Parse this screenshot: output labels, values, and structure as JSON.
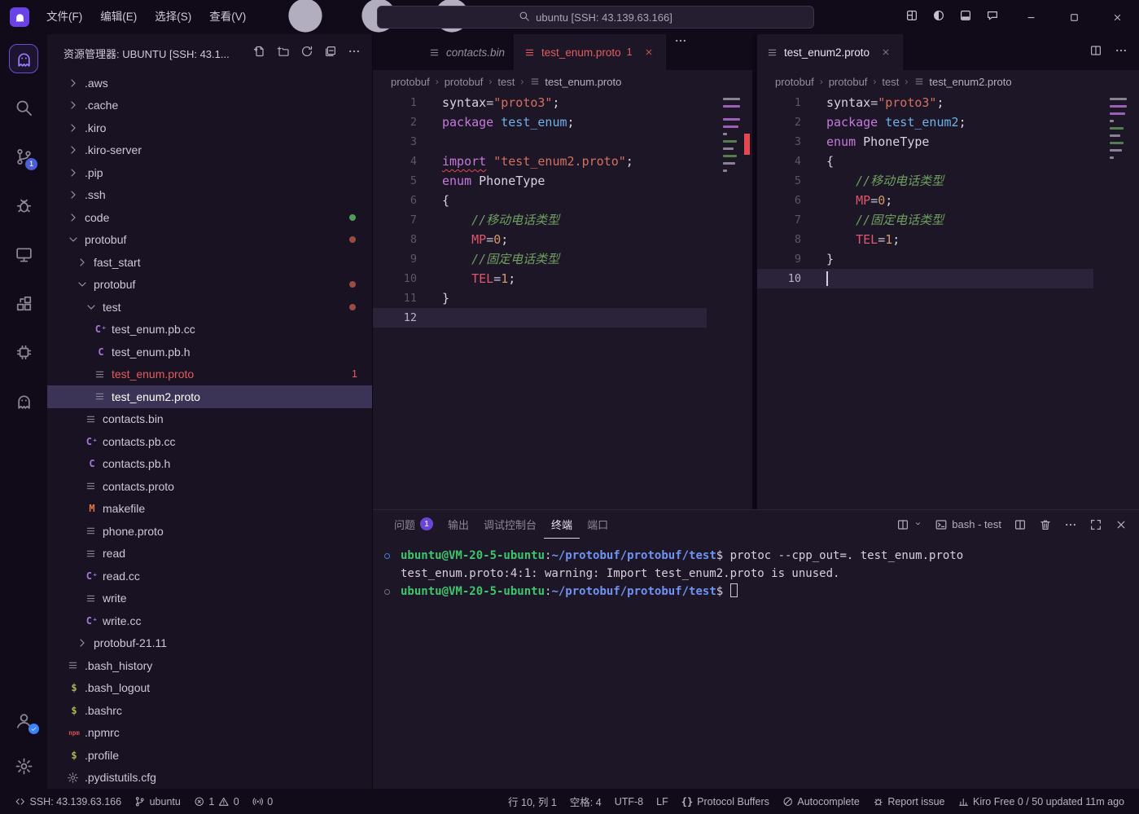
{
  "window": {
    "menus": [
      "文件(F)",
      "编辑(E)",
      "选择(S)",
      "查看(V)"
    ],
    "back": "←",
    "forward": "→",
    "search_text": "ubuntu [SSH: 43.139.63.166]",
    "title_actions": [
      {
        "name": "customize-layout",
        "icon": "layout-grid"
      },
      {
        "name": "toggle-sidebar",
        "icon": "circle-half"
      },
      {
        "name": "toggle-panel",
        "icon": "panel-bottom"
      },
      {
        "name": "chat",
        "icon": "chat"
      }
    ],
    "controls": [
      {
        "name": "minimize",
        "icon": "minimize"
      },
      {
        "name": "maximize",
        "icon": "maximize"
      },
      {
        "name": "close-window",
        "icon": "close"
      }
    ]
  },
  "activity_bar": {
    "top": [
      {
        "name": "kiro",
        "icon": "ghost",
        "active": true
      },
      {
        "name": "search",
        "icon": "search"
      },
      {
        "name": "source-control",
        "icon": "source-control",
        "badge": "1"
      },
      {
        "name": "run-debug",
        "icon": "debug"
      },
      {
        "name": "remote-explorer",
        "icon": "monitor"
      },
      {
        "name": "extensions",
        "icon": "extensions"
      },
      {
        "name": "kiro-agent",
        "icon": "cpu"
      },
      {
        "name": "kiro-chat",
        "icon": "ghost"
      }
    ],
    "bottom": [
      {
        "name": "accounts",
        "icon": "account",
        "check": true
      },
      {
        "name": "settings",
        "icon": "gear"
      }
    ]
  },
  "sidebar": {
    "title": "资源管理器: UBUNTU [SSH: 43.1...",
    "actions": [
      {
        "name": "new-file",
        "icon": "new-file"
      },
      {
        "name": "new-folder",
        "icon": "new-folder"
      },
      {
        "name": "refresh-explorer",
        "icon": "refresh"
      },
      {
        "name": "collapse-folders",
        "icon": "collapse-all"
      },
      {
        "name": "views-more",
        "icon": "more"
      }
    ],
    "tree": [
      {
        "label": ".aws",
        "depth": 0,
        "kind": "folder"
      },
      {
        "label": ".cache",
        "depth": 0,
        "kind": "folder"
      },
      {
        "label": ".kiro",
        "depth": 0,
        "kind": "folder"
      },
      {
        "label": ".kiro-server",
        "depth": 0,
        "kind": "folder"
      },
      {
        "label": ".pip",
        "depth": 0,
        "kind": "folder"
      },
      {
        "label": ".ssh",
        "depth": 0,
        "kind": "folder"
      },
      {
        "label": "code",
        "depth": 0,
        "kind": "folder",
        "dot": "green"
      },
      {
        "label": "protobuf",
        "depth": 0,
        "kind": "folder",
        "expanded": true,
        "dot": "red"
      },
      {
        "label": "fast_start",
        "depth": 1,
        "kind": "folder"
      },
      {
        "label": "protobuf",
        "depth": 1,
        "kind": "folder",
        "expanded": true,
        "dot": "red"
      },
      {
        "label": "test",
        "depth": 2,
        "kind": "folder",
        "expanded": true,
        "dot": "red"
      },
      {
        "label": "test_enum.pb.cc",
        "depth": 3,
        "kind": "file",
        "icon": "cpp"
      },
      {
        "label": "test_enum.pb.h",
        "depth": 3,
        "kind": "file",
        "icon": "c"
      },
      {
        "label": "test_enum.proto",
        "depth": 3,
        "kind": "file",
        "icon": "lines",
        "error": true,
        "badge": "1"
      },
      {
        "label": "test_enum2.proto",
        "depth": 3,
        "kind": "file",
        "icon": "lines",
        "selected": true
      },
      {
        "label": "contacts.bin",
        "depth": 2,
        "kind": "file",
        "icon": "lines"
      },
      {
        "label": "contacts.pb.cc",
        "depth": 2,
        "kind": "file",
        "icon": "cpp"
      },
      {
        "label": "contacts.pb.h",
        "depth": 2,
        "kind": "file",
        "icon": "c"
      },
      {
        "label": "contacts.proto",
        "depth": 2,
        "kind": "file",
        "icon": "lines"
      },
      {
        "label": "makefile",
        "depth": 2,
        "kind": "file",
        "icon": "make"
      },
      {
        "label": "phone.proto",
        "depth": 2,
        "kind": "file",
        "icon": "lines"
      },
      {
        "label": "read",
        "depth": 2,
        "kind": "file",
        "icon": "lines"
      },
      {
        "label": "read.cc",
        "depth": 2,
        "kind": "file",
        "icon": "cpp"
      },
      {
        "label": "write",
        "depth": 2,
        "kind": "file",
        "icon": "lines"
      },
      {
        "label": "write.cc",
        "depth": 2,
        "kind": "file",
        "icon": "cpp"
      },
      {
        "label": "protobuf-21.11",
        "depth": 1,
        "kind": "folder"
      },
      {
        "label": ".bash_history",
        "depth": 0,
        "kind": "file",
        "icon": "lines"
      },
      {
        "label": ".bash_logout",
        "depth": 0,
        "kind": "file",
        "icon": "shell"
      },
      {
        "label": ".bashrc",
        "depth": 0,
        "kind": "file",
        "icon": "shell"
      },
      {
        "label": ".npmrc",
        "depth": 0,
        "kind": "file",
        "icon": "npm"
      },
      {
        "label": ".profile",
        "depth": 0,
        "kind": "file",
        "icon": "shell"
      },
      {
        "label": ".pydistutils.cfg",
        "depth": 0,
        "kind": "file",
        "icon": "gear"
      }
    ]
  },
  "editor_groups": [
    {
      "tabs": [
        {
          "label": "contacts.bin",
          "icon": "lines",
          "preview": true
        },
        {
          "label": "test_enum.proto",
          "icon": "lines",
          "error": true,
          "count": "1",
          "close": true,
          "active": true
        }
      ],
      "overflow": true,
      "breadcrumbs": [
        "protobuf",
        "protobuf",
        "test"
      ],
      "file": "test_enum.proto",
      "active_line": 12,
      "cursor": false,
      "error_mark": true,
      "code": [
        [
          [
            "p",
            "syntax"
          ],
          [
            "o",
            "="
          ],
          [
            "s",
            "\"proto3\""
          ],
          [
            "p",
            ";"
          ]
        ],
        [
          [
            "k",
            "package"
          ],
          [
            "p",
            " "
          ],
          [
            "t",
            "test_enum"
          ],
          [
            "p",
            ";"
          ]
        ],
        [],
        [
          [
            "kq",
            "import"
          ],
          [
            "p",
            " "
          ],
          [
            "s",
            "\"test_enum2.proto\""
          ],
          [
            "p",
            ";"
          ]
        ],
        [
          [
            "k",
            "enum"
          ],
          [
            "p",
            " "
          ],
          [
            "p",
            "PhoneType"
          ]
        ],
        [
          [
            "p",
            "{"
          ]
        ],
        [
          [
            "c",
            "    //移动电话类型"
          ]
        ],
        [
          [
            "p",
            "    "
          ],
          [
            "v",
            "MP"
          ],
          [
            "o",
            "="
          ],
          [
            "n",
            "0"
          ],
          [
            "p",
            ";"
          ]
        ],
        [
          [
            "c",
            "    //固定电话类型"
          ]
        ],
        [
          [
            "p",
            "    "
          ],
          [
            "v",
            "TEL"
          ],
          [
            "o",
            "="
          ],
          [
            "n",
            "1"
          ],
          [
            "p",
            ";"
          ]
        ],
        [
          [
            "p",
            "}"
          ]
        ],
        []
      ]
    },
    {
      "tabs": [
        {
          "label": "test_enum2.proto",
          "icon": "lines",
          "close": true,
          "active": true
        }
      ],
      "actions": [
        {
          "name": "split-editor",
          "icon": "split-editor"
        },
        {
          "name": "editor-more",
          "icon": "more"
        }
      ],
      "breadcrumbs": [
        "protobuf",
        "protobuf",
        "test"
      ],
      "file": "test_enum2.proto",
      "active_line": 10,
      "cursor": true,
      "error_mark": false,
      "code": [
        [
          [
            "p",
            "syntax"
          ],
          [
            "o",
            "="
          ],
          [
            "s",
            "\"proto3\""
          ],
          [
            "p",
            ";"
          ]
        ],
        [
          [
            "k",
            "package"
          ],
          [
            "p",
            " "
          ],
          [
            "t",
            "test_enum2"
          ],
          [
            "p",
            ";"
          ]
        ],
        [
          [
            "k",
            "enum"
          ],
          [
            "p",
            " "
          ],
          [
            "p",
            "PhoneType"
          ]
        ],
        [
          [
            "p",
            "{"
          ]
        ],
        [
          [
            "c",
            "    //移动电话类型"
          ]
        ],
        [
          [
            "p",
            "    "
          ],
          [
            "v",
            "MP"
          ],
          [
            "o",
            "="
          ],
          [
            "n",
            "0"
          ],
          [
            "p",
            ";"
          ]
        ],
        [
          [
            "c",
            "    //固定电话类型"
          ]
        ],
        [
          [
            "p",
            "    "
          ],
          [
            "v",
            "TEL"
          ],
          [
            "o",
            "="
          ],
          [
            "n",
            "1"
          ],
          [
            "p",
            ";"
          ]
        ],
        [
          [
            "p",
            "}"
          ]
        ],
        []
      ]
    }
  ],
  "panel": {
    "tabs": [
      {
        "label": "问题",
        "badge": "1"
      },
      {
        "label": "输出"
      },
      {
        "label": "调试控制台"
      },
      {
        "label": "终端",
        "active": true
      },
      {
        "label": "端口"
      }
    ],
    "actions": [
      {
        "name": "launch-profile",
        "icon": "split-editor",
        "caret": true
      },
      {
        "name": "terminal-instance",
        "icon": "terminal",
        "label": "bash - test"
      },
      {
        "name": "split-terminal",
        "icon": "split-editor"
      },
      {
        "name": "kill-terminal",
        "icon": "trash"
      },
      {
        "name": "terminal-more",
        "icon": "more"
      },
      {
        "name": "maximize-panel",
        "icon": "expand"
      },
      {
        "name": "close-panel",
        "icon": "close"
      }
    ],
    "terminal_lines": [
      {
        "marker": "active",
        "segments": [
          [
            "u",
            "ubuntu@VM-20-5-ubuntu"
          ],
          [
            "p",
            ":"
          ],
          [
            "d",
            "~/protobuf/protobuf/test"
          ],
          [
            "p",
            "$ protoc --cpp_out=. test_enum.proto"
          ]
        ]
      },
      {
        "marker": "",
        "segments": [
          [
            "p",
            "test_enum.proto:4:1: warning: Import test_enum2.proto is unused."
          ]
        ]
      },
      {
        "marker": "idle",
        "segments": [
          [
            "u",
            "ubuntu@VM-20-5-ubuntu"
          ],
          [
            "p",
            ":"
          ],
          [
            "d",
            "~/protobuf/protobuf/test"
          ],
          [
            "p",
            "$ "
          ],
          [
            "cursor",
            ""
          ]
        ]
      }
    ]
  },
  "status_bar": {
    "left": [
      {
        "name": "remote",
        "parts": [
          [
            "icon",
            "remote"
          ],
          [
            "text",
            "SSH: 43.139.63.166"
          ]
        ]
      },
      {
        "name": "branch",
        "parts": [
          [
            "icon",
            "source-control"
          ],
          [
            "text",
            "ubuntu"
          ]
        ]
      },
      {
        "name": "problems",
        "parts": [
          [
            "icon",
            "error-circle"
          ],
          [
            "text",
            "1"
          ],
          [
            "icon",
            "warning"
          ],
          [
            "text",
            "0"
          ]
        ]
      },
      {
        "name": "ports",
        "parts": [
          [
            "icon",
            "radio"
          ],
          [
            "text",
            "0"
          ]
        ]
      }
    ],
    "right": [
      {
        "name": "cursor-position",
        "parts": [
          [
            "text",
            "行 10, 列 1"
          ]
        ]
      },
      {
        "name": "indentation",
        "parts": [
          [
            "text",
            "空格: 4"
          ]
        ]
      },
      {
        "name": "encoding",
        "parts": [
          [
            "text",
            "UTF-8"
          ]
        ]
      },
      {
        "name": "eol",
        "parts": [
          [
            "text",
            "LF"
          ]
        ]
      },
      {
        "name": "language-mode",
        "parts": [
          [
            "icon",
            "braces"
          ],
          [
            "text",
            "Protocol Buffers"
          ]
        ]
      },
      {
        "name": "autocomplete",
        "parts": [
          [
            "icon",
            "slash-circle"
          ],
          [
            "text",
            "Autocomplete"
          ]
        ]
      },
      {
        "name": "report-issue",
        "parts": [
          [
            "icon",
            "bug"
          ],
          [
            "text",
            "Report issue"
          ]
        ]
      },
      {
        "name": "kiro-usage",
        "parts": [
          [
            "icon",
            "chart"
          ],
          [
            "text",
            "Kiro Free 0 / 50 updated 11m ago"
          ]
        ]
      }
    ]
  }
}
